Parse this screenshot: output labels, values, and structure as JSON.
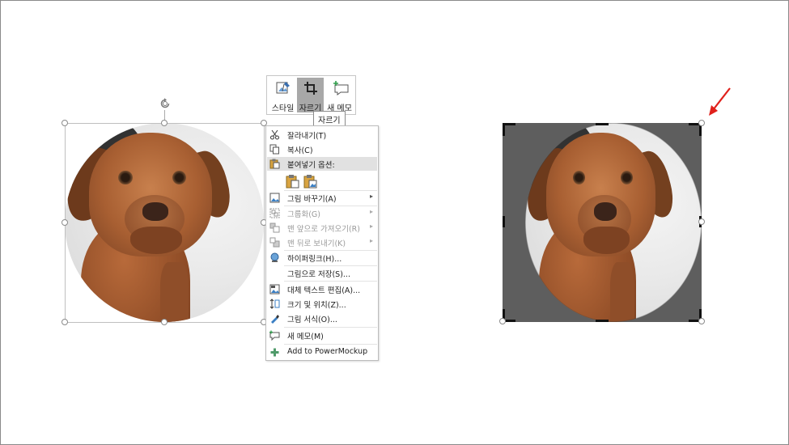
{
  "mini_toolbar": {
    "buttons": [
      {
        "label": "스타일",
        "icon": "style-icon"
      },
      {
        "label": "자르기",
        "icon": "crop-icon",
        "active": true
      },
      {
        "label": "새 메모",
        "icon": "new-comment-icon"
      }
    ]
  },
  "tooltip": {
    "text": "자르기"
  },
  "context_menu": {
    "items": [
      {
        "label": "잘라내기(T)",
        "icon": "scissors-icon"
      },
      {
        "label": "복사(C)",
        "icon": "copy-icon"
      },
      {
        "label": "붙여넣기 옵션:",
        "icon": "paste-icon"
      },
      {
        "label": "그림 바꾸기(A)",
        "icon": "change-picture-icon",
        "submenu": true
      },
      {
        "label": "그룹화(G)",
        "icon": "group-icon",
        "submenu": true,
        "disabled": true
      },
      {
        "label": "맨 앞으로 가져오기(R)",
        "icon": "bring-front-icon",
        "submenu": true,
        "disabled": true
      },
      {
        "label": "맨 뒤로 보내기(K)",
        "icon": "send-back-icon",
        "submenu": true,
        "disabled": true
      },
      {
        "label": "하이퍼링크(H)...",
        "icon": "hyperlink-icon"
      },
      {
        "label": "그림으로 저장(S)...",
        "icon": ""
      },
      {
        "label": "대체 텍스트 편집(A)...",
        "icon": "alt-text-icon"
      },
      {
        "label": "크기 및 위치(Z)...",
        "icon": "size-position-icon"
      },
      {
        "label": "그림 서식(O)...",
        "icon": "format-picture-icon"
      },
      {
        "label": "새 메모(M)",
        "icon": "new-comment-icon"
      },
      {
        "label": "Add to PowerMockup",
        "icon": "plus-icon"
      }
    ],
    "submenu_glyph": "▸"
  },
  "colors": {
    "accent_red": "#e0201b",
    "highlight": "#e1e1e1",
    "active_button": "#a8a8a8"
  }
}
